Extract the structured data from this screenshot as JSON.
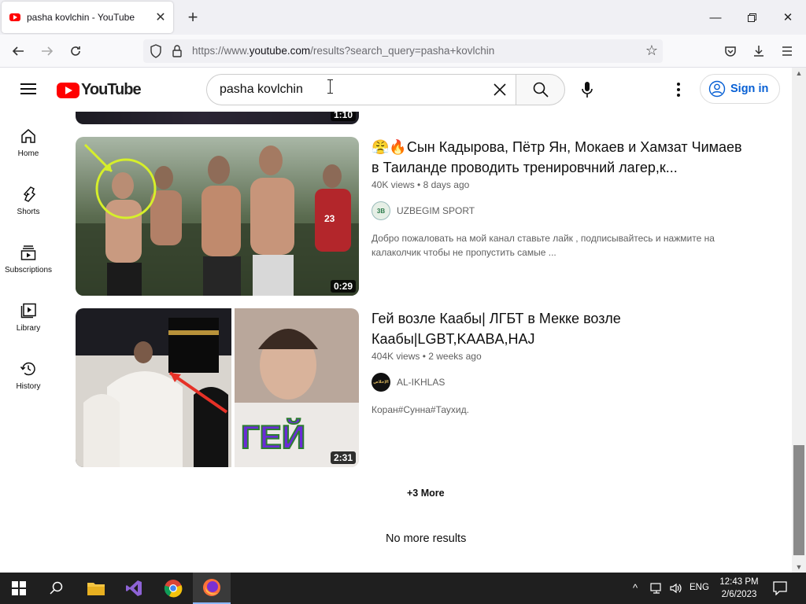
{
  "browser": {
    "tab_title": "pasha kovlchin - YouTube",
    "url_prefix": "https://www.",
    "url_domain": "youtube.com",
    "url_path": "/results?search_query=pasha+kovlchin"
  },
  "masthead": {
    "logo_text": "YouTube",
    "search_value": "pasha kovlchin",
    "signin_label": "Sign in"
  },
  "guide": {
    "items": [
      {
        "label": "Home",
        "icon": "home-icon"
      },
      {
        "label": "Shorts",
        "icon": "shorts-icon"
      },
      {
        "label": "Subscriptions",
        "icon": "subscriptions-icon"
      },
      {
        "label": "Library",
        "icon": "library-icon"
      },
      {
        "label": "History",
        "icon": "history-icon"
      }
    ]
  },
  "results": {
    "previous_duration": "1:10",
    "videos": [
      {
        "title": "😤🔥Сын Кадырова, Пётр Ян, Мокаев и Хамзат Чимаев в Таиланде проводить тренировчний лагер,к...",
        "views": "40K views",
        "age": "8 days ago",
        "channel": "UZBEGIM SPORT",
        "channel_avatar_text": "3B",
        "description": "Добро пожаловать на мой канал ставьте лайк , подписывайтесь и нажмите на калаколчик чтобы не пропустить самые ...",
        "duration": "0:29"
      },
      {
        "title": "Гей возле Каабы| ЛГБТ в Мекке возле Каабы|LGBT,KAABA,HAJ",
        "views": "404K views",
        "age": "2 weeks ago",
        "channel": "AL-IKHLAS",
        "channel_avatar_text": "الإخلاص",
        "description": "Коран#Сунна#Таухид.",
        "duration": "2:31",
        "thumb_text": "ГЕЙ"
      }
    ],
    "more_label": "+3 More",
    "no_more_label": "No more results"
  },
  "taskbar": {
    "language": "ENG",
    "time": "12:43 PM",
    "date": "2/6/2023"
  },
  "colors": {
    "accent_blue": "#065fd4",
    "youtube_red": "#ff0000"
  }
}
